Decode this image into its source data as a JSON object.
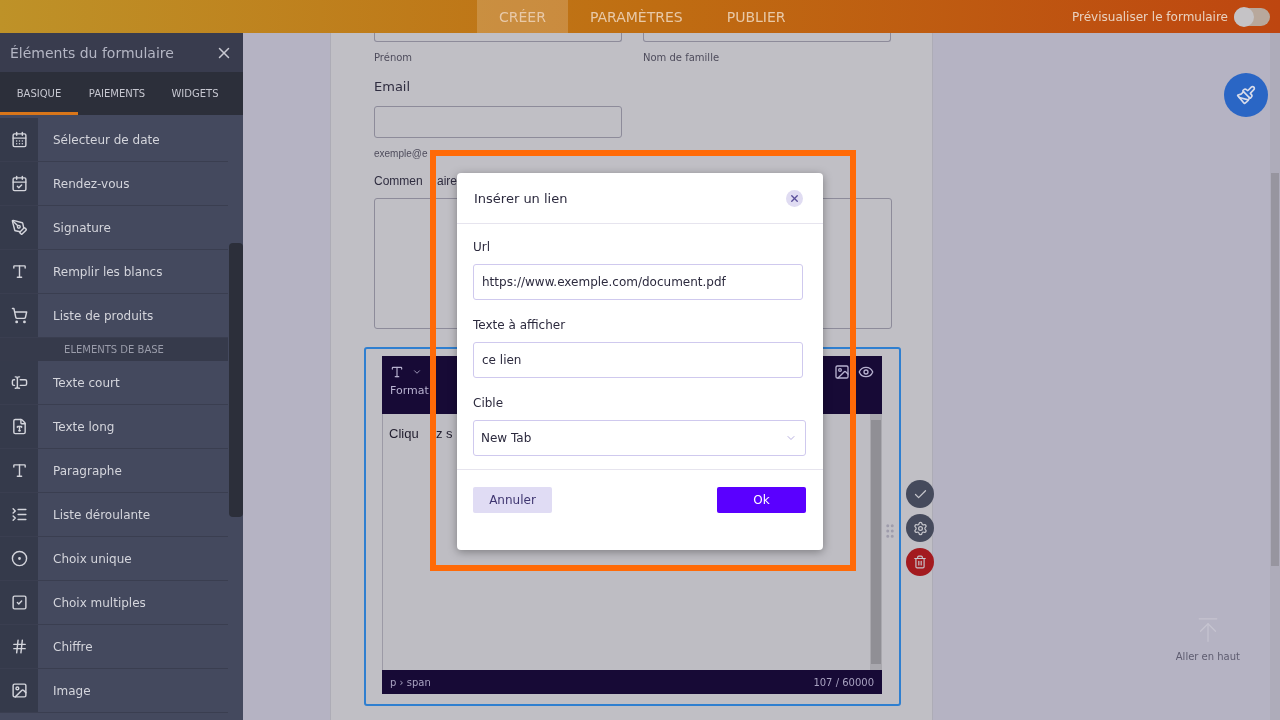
{
  "header": {
    "tabs": [
      {
        "label": "CRÉER",
        "selected": true
      },
      {
        "label": "PARAMÈTRES",
        "selected": false
      },
      {
        "label": "PUBLIER",
        "selected": false
      }
    ],
    "preview": {
      "label": "Prévisualiser le formulaire",
      "on": false
    }
  },
  "sidebar": {
    "title": "Éléments du formulaire",
    "tabs": [
      {
        "label": "BASIQUE",
        "selected": true
      },
      {
        "label": "PAIEMENTS",
        "selected": false
      },
      {
        "label": "WIDGETS",
        "selected": false
      }
    ],
    "items": [
      {
        "kind": "date",
        "label": "Sélecteur de date"
      },
      {
        "kind": "appointment",
        "label": "Rendez-vous"
      },
      {
        "kind": "signature",
        "label": "Signature"
      },
      {
        "kind": "fill-blanks",
        "label": "Remplir les blancs"
      },
      {
        "kind": "products",
        "label": "Liste de produits"
      },
      {
        "kind": "section",
        "label": "ELEMENTS DE BASE"
      },
      {
        "kind": "short-text",
        "label": "Texte court"
      },
      {
        "kind": "long-text",
        "label": "Texte long"
      },
      {
        "kind": "paragraph",
        "label": "Paragraphe"
      },
      {
        "kind": "dropdown",
        "label": "Liste déroulante"
      },
      {
        "kind": "single-choice",
        "label": "Choix unique"
      },
      {
        "kind": "multiple-choice",
        "label": "Choix multiples"
      },
      {
        "kind": "number",
        "label": "Chiffre"
      },
      {
        "kind": "image",
        "label": "Image"
      }
    ]
  },
  "form": {
    "first_name_label": "Prénom",
    "last_name_label": "Nom de famille",
    "email": {
      "label": "Email",
      "hint": [
        "exemple@e"
      ]
    },
    "comment": {
      "label": [
        "Commen",
        "aire"
      ]
    },
    "editor": {
      "formats": [
        "Format"
      ],
      "text": [
        "Cliqu",
        "z s"
      ],
      "path": "p › span",
      "count": "107 / 60000"
    }
  },
  "scroll_top": {
    "label": "Aller en haut"
  },
  "dialog": {
    "title": "Insérer un lien",
    "url": {
      "label": "Url",
      "value": "https://www.exemple.com/document.pdf"
    },
    "text": {
      "label": "Texte à afficher",
      "value": "ce lien"
    },
    "target": {
      "label": "Cible",
      "value": "New Tab"
    },
    "cancel": "Annuler",
    "ok": "Ok"
  }
}
